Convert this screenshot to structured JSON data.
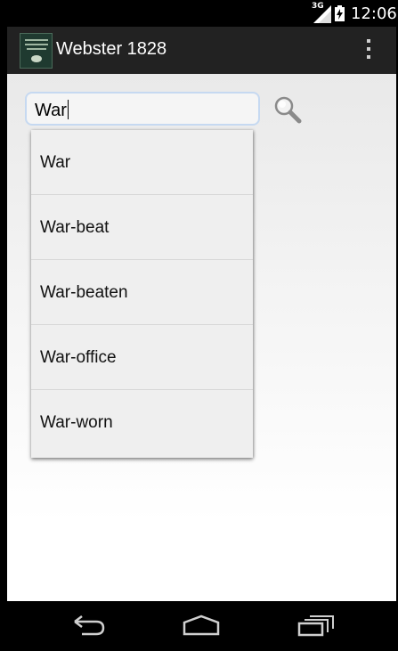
{
  "status_bar": {
    "network": "3G",
    "time": "12:06"
  },
  "action_bar": {
    "title": "Webster 1828",
    "app_icon": "book-cover-icon",
    "overflow_icon": "overflow-menu-icon"
  },
  "search": {
    "value": "War",
    "button_icon": "magnifier-icon"
  },
  "suggestions": [
    {
      "label": "War"
    },
    {
      "label": "War-beat"
    },
    {
      "label": "War-beaten"
    },
    {
      "label": "War-office"
    },
    {
      "label": "War-worn"
    }
  ],
  "nav_bar": {
    "back_icon": "back-icon",
    "home_icon": "home-icon",
    "recent_icon": "recent-apps-icon"
  },
  "colors": {
    "action_bar": "#222222",
    "search_border": "#c6d9f1",
    "dropdown_bg": "#efefef"
  }
}
